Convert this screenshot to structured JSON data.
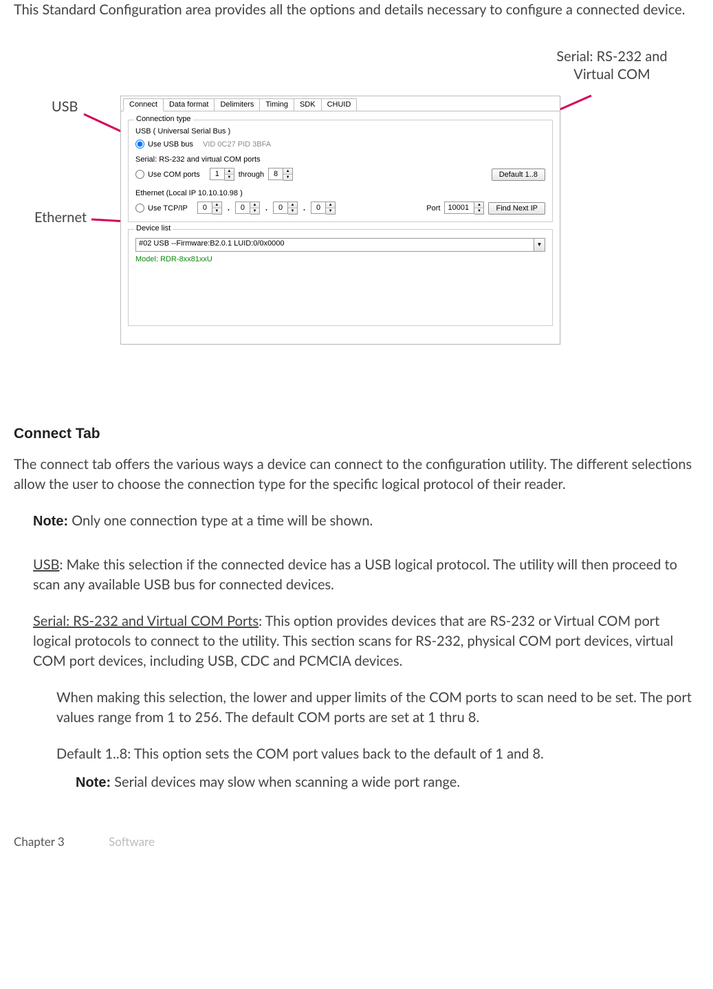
{
  "intro": "This Standard Configuration area provides all the options and details necessary to configure a connected device.",
  "callouts": {
    "usb": "USB",
    "serial": "Serial: RS-232 and Virtual COM",
    "ethernet": "Ethernet"
  },
  "dialog": {
    "tabs": [
      "Connect",
      "Data format",
      "Delimiters",
      "Timing",
      "SDK",
      "CHUID"
    ],
    "active_tab_index": 0,
    "conn_group_title": "Connection type",
    "usb": {
      "title": "USB ( Universal Serial Bus )",
      "radio_label": "Use USB bus",
      "vidpid": "VID 0C27 PID 3BFA"
    },
    "serial": {
      "title": "Serial: RS-232 and virtual COM ports",
      "radio_label": "Use COM ports",
      "from": "1",
      "through_label": "through",
      "to": "8",
      "default_btn": "Default 1..8"
    },
    "ethernet": {
      "title": "Ethernet (Local IP 10.10.10.98 )",
      "radio_label": "Use TCP/IP",
      "ip": [
        "0",
        "0",
        "0",
        "0"
      ],
      "port_label": "Port",
      "port": "10001",
      "find_btn": "Find Next IP"
    },
    "devicelist": {
      "title": "Device list",
      "selected": "#02 USB --Firmware:B2.0.1 LUID:0/0x0000",
      "model": "Model: RDR-8xx81xxU"
    }
  },
  "section": {
    "heading": "Connect Tab",
    "p1": "The connect tab offers the various ways a device can connect to the configuration utility. The different selections allow the user to choose the connection type for the specific logical protocol of their reader.",
    "note1_label": "Note:",
    "note1_text": " Only one connection type at a time will be shown.",
    "usb_label": "USB",
    "usb_text": ": Make this selection if the connected device has a USB logical protocol. The utility will then proceed to scan any available USB bus for connected devices.",
    "serial_label": "Serial: RS-232 and Virtual COM Ports",
    "serial_text": ": This option provides devices that are RS-232 or Virtual COM port logical protocols to connect to the utility. This section scans for RS-232, physical COM port devices, virtual COM port devices, including USB, CDC and PCMCIA devices.",
    "serial_sub1": "When making this selection, the lower and upper limits of the COM ports to scan need to be set. The port values range from 1 to 256. The default COM ports are set at 1 thru 8.",
    "serial_sub2": "Default 1..8: This option sets the COM port values back to the default of 1 and 8.",
    "note2_label": "Note:",
    "note2_text": " Serial devices may slow when scanning a wide port range."
  },
  "footer": {
    "chapter": "Chapter 3",
    "title": "Software"
  },
  "colors": {
    "arrow": "#d6005a"
  }
}
